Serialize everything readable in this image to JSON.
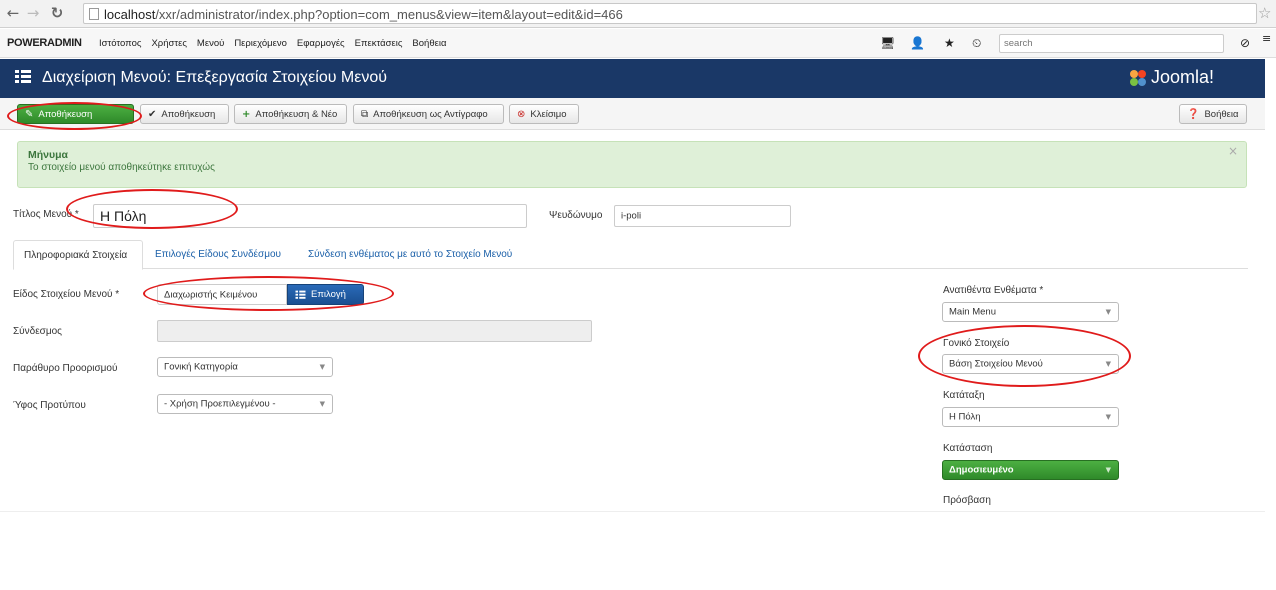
{
  "browser": {
    "url_host": "localhost",
    "url_path": "/xxr/administrator/index.php?option=com_menus&view=item&layout=edit&id=466"
  },
  "admin_nav": {
    "brand": "POWERADMIN",
    "items": [
      "Ιστότοπος",
      "Χρήστες",
      "Μενού",
      "Περιεχόμενο",
      "Εφαρμογές",
      "Επεκτάσεις",
      "Βοήθεια"
    ],
    "search_placeholder": "search"
  },
  "header": {
    "title": "Διαχείριση Μενού: Επεξεργασία Στοιχείου Μενού",
    "logo_text": "Joomla!"
  },
  "toolbar": {
    "save": "Αποθήκευση",
    "save_close": "Αποθήκευση",
    "save_new": "Αποθήκευση & Νέο",
    "save_copy": "Αποθήκευση ως Αντίγραφο",
    "close": "Κλείσιμο",
    "help": "Βοήθεια"
  },
  "alert": {
    "heading": "Μήνυμα",
    "text": "Το στοιχείο μενού αποθηκεύτηκε επιτυχώς"
  },
  "form": {
    "title_label": "Τίτλος Μενού *",
    "title_value": "Η Πόλη",
    "alias_label": "Ψευδώνυμο",
    "alias_value": "i-poli",
    "tabs": [
      "Πληροφοριακά Στοιχεία",
      "Επιλογές Είδους Συνδέσμου",
      "Σύνδεση ενθέματος με αυτό το Στοιχείο Μενού"
    ],
    "type_label": "Είδος Στοιχείου Μενού *",
    "type_value": "Διαχωριστής Κειμένου",
    "select_button": "Επιλογή",
    "link_label": "Σύνδεσμος",
    "target_label": "Παράθυρο Προορισμού",
    "target_value": "Γονική Κατηγορία",
    "style_label": "Ύφος Προτύπου",
    "style_value": "- Χρήση Προεπιλεγμένου -"
  },
  "sidebar": {
    "menu_label": "Ανατιθέντα Ενθέματα *",
    "menu_value": "Main Menu",
    "parent_label": "Γονικό Στοιχείο",
    "parent_value": "Βάση Στοιχείου Μενού",
    "order_label": "Κατάταξη",
    "order_value": "Η Πόλη",
    "status_label": "Κατάσταση",
    "status_value": "Δημοσιευμένο",
    "access_label": "Πρόσβαση"
  },
  "colors": {
    "header_bg": "#1a3867",
    "primary_green": "#2f8a2a",
    "alert_bg": "#dff0d8",
    "annotation_red": "#e01b1b"
  }
}
